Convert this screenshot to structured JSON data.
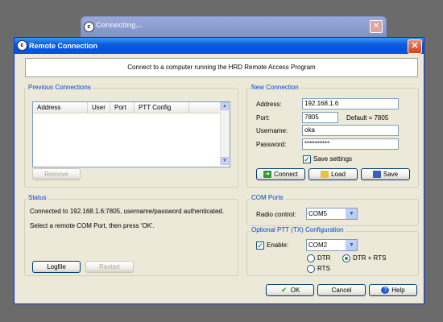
{
  "background_window": {
    "title": "Connecting...",
    "close_glyph": "✕"
  },
  "dialog": {
    "title": "Remote Connection",
    "close_glyph": "✕",
    "app_icon": "c",
    "banner": "Connect to a computer running the HRD Remote Access Program"
  },
  "previous_connections": {
    "label": "Previous Connections",
    "columns": [
      "Address",
      "User",
      "Port",
      "PTT Config"
    ],
    "rows": [],
    "remove_label": "Remove"
  },
  "new_connection": {
    "label": "New Connection",
    "address_label": "Address:",
    "address_value": "192.168.1.6",
    "port_label": "Port:",
    "port_value": "7805",
    "default_text": "Default = 7805",
    "username_label": "Username:",
    "username_value": "oka",
    "password_label": "Password:",
    "password_value": "**********",
    "save_settings_label": "Save settings",
    "save_settings_checked": true,
    "connect_label": "Connect",
    "load_label": "Load",
    "save_label": "Save"
  },
  "status": {
    "label": "Status",
    "line1": "Connected to 192.168.1.6:7805, username/password authenticated.",
    "line2": "Select a remote COM Port, then press 'OK'.",
    "logfile_label": "Logfile",
    "restart_label": "Restart"
  },
  "com_ports": {
    "label": "COM Ports",
    "radio_control_label": "Radio control:",
    "radio_control_value": "COM5"
  },
  "ptt": {
    "label": "Optional PTT (TX) Configuration",
    "enable_label": "Enable:",
    "enable_checked": true,
    "port_value": "COM2",
    "dtr_label": "DTR",
    "dtr_rts_label": "DTR + RTS",
    "rts_label": "RTS",
    "selected": "DTR + RTS"
  },
  "footer": {
    "ok_label": "OK",
    "cancel_label": "Cancel",
    "help_label": "Help"
  },
  "colors": {
    "title_bar": "#0054e3",
    "group_label": "#0046d5",
    "check": "#21a121",
    "dialog_bg": "#ece9d8"
  }
}
